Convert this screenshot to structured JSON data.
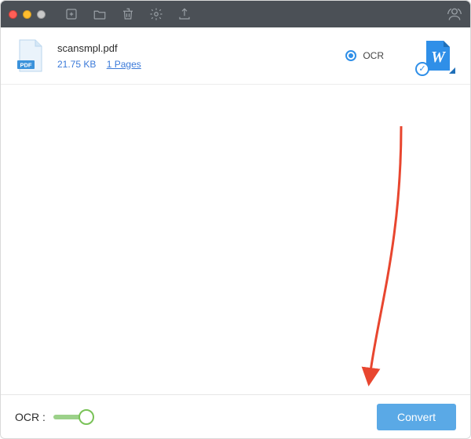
{
  "file": {
    "name": "scansmpl.pdf",
    "size": "21.75 KB",
    "pages_label": "1 Pages"
  },
  "row": {
    "ocr_label": "OCR",
    "ocr_enabled": true
  },
  "footer": {
    "ocr_label": "OCR :",
    "convert_label": "Convert"
  }
}
